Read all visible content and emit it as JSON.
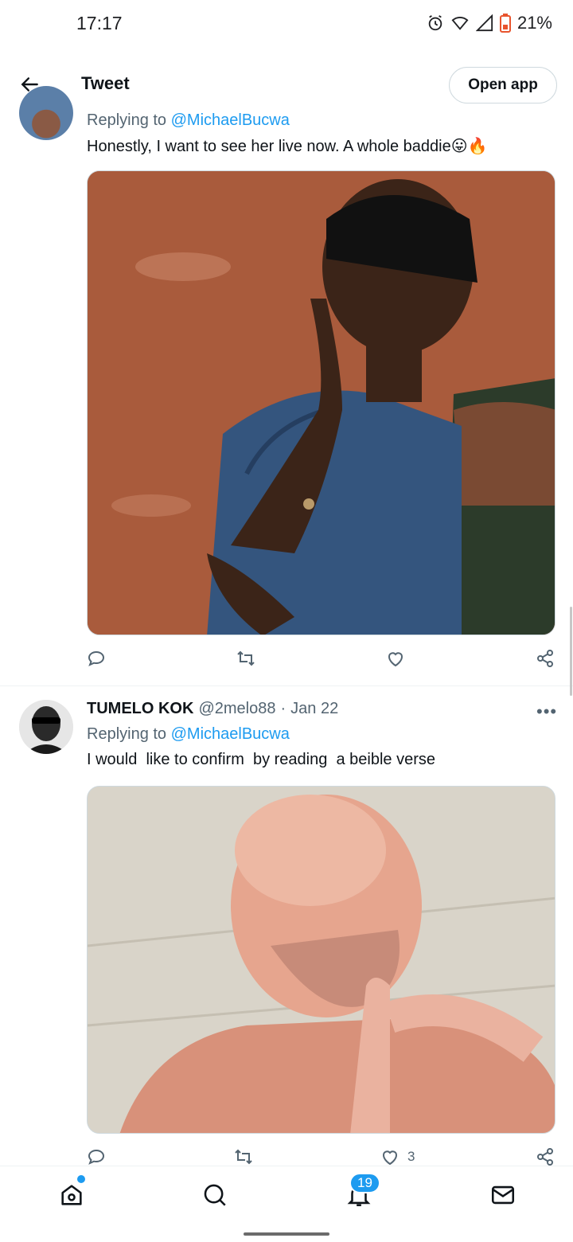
{
  "status_bar": {
    "time": "17:17",
    "battery": "21%"
  },
  "header": {
    "title": "Tweet",
    "open_app": "Open app"
  },
  "tweets": [
    {
      "replying_prefix": "Replying to",
      "replying_to": "@MichaelBucwa",
      "text": "Honestly, I want to see her live now. A whole baddie",
      "emoji": "😛🔥"
    },
    {
      "name": "TUMELO KOK",
      "handle": "@2melo88",
      "separator": "·",
      "date": "Jan 22",
      "replying_prefix": "Replying to",
      "replying_to": "@MichaelBucwa",
      "text": "I would  like to confirm  by reading  a beible verse",
      "like_count": "3"
    }
  ],
  "more_menu": "•••",
  "bottom_nav": {
    "notifications_badge": "19"
  },
  "colors": {
    "accent": "#1d9bf0",
    "muted": "#536471",
    "text": "#0f1419"
  }
}
